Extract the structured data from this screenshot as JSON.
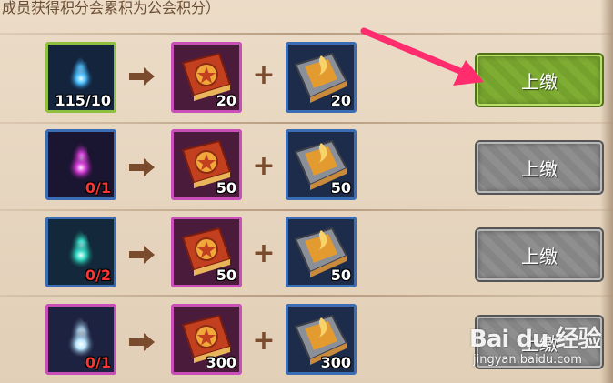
{
  "header": {
    "text": "成员获得积分会累积为公会积分）"
  },
  "rows": [
    {
      "source": {
        "icon": "blue-spirit-flame-icon",
        "count": "115/10",
        "count_color": "#ffffff",
        "frame": "green"
      },
      "item1": {
        "icon": "red-star-book-icon",
        "count": "20"
      },
      "item2": {
        "icon": "golden-tome-icon",
        "count": "20"
      },
      "button": {
        "label": "上缴",
        "state": "active"
      }
    },
    {
      "source": {
        "icon": "purple-spirit-flame-icon",
        "count": "0/1",
        "count_color": "#ff3333",
        "frame": "blue"
      },
      "item1": {
        "icon": "red-star-book-icon",
        "count": "50"
      },
      "item2": {
        "icon": "golden-tome-icon",
        "count": "50"
      },
      "button": {
        "label": "上缴",
        "state": "disabled"
      }
    },
    {
      "source": {
        "icon": "teal-spirit-flame-icon",
        "count": "0/2",
        "count_color": "#ff3333",
        "frame": "blue"
      },
      "item1": {
        "icon": "red-star-book-icon",
        "count": "50"
      },
      "item2": {
        "icon": "golden-tome-icon",
        "count": "50"
      },
      "button": {
        "label": "上缴",
        "state": "disabled"
      }
    },
    {
      "source": {
        "icon": "white-spirit-flame-icon",
        "count": "0/1",
        "count_color": "#ff3333",
        "frame": "pink"
      },
      "item1": {
        "icon": "red-star-book-icon",
        "count": "300"
      },
      "item2": {
        "icon": "golden-tome-icon",
        "count": "300"
      },
      "button": {
        "label": "上缴",
        "state": "disabled"
      }
    }
  ],
  "watermark": {
    "brand": "Bai du 经验",
    "url": "jingyan.baidu.com"
  },
  "colors": {
    "active_button": "#7fac33",
    "disabled_button": "#8f8f8f",
    "pointer_arrow": "#ff2d6e"
  }
}
